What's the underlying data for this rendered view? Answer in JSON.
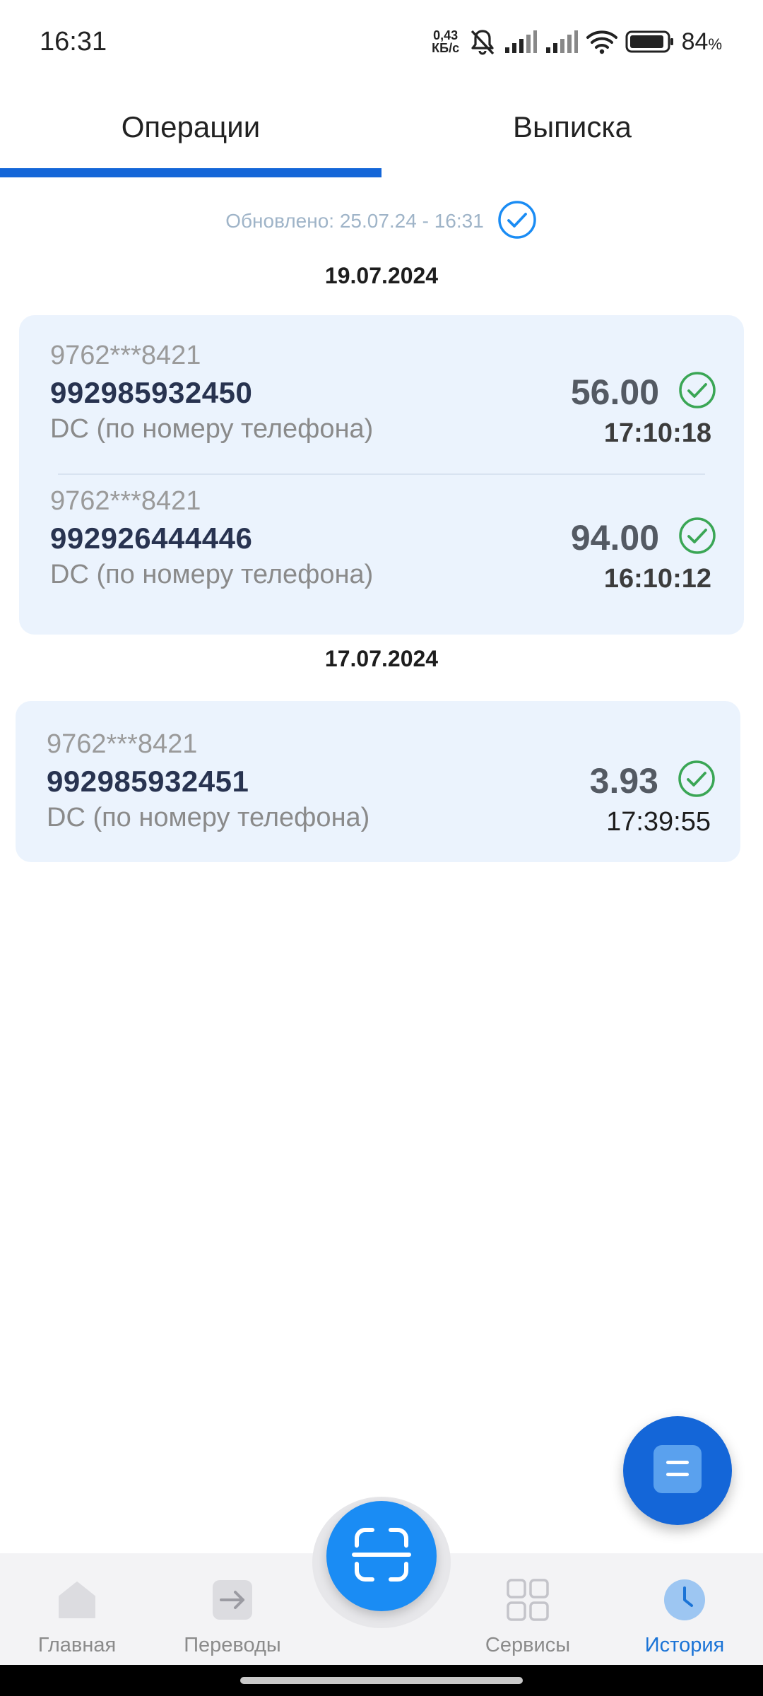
{
  "status_bar": {
    "time": "16:31",
    "net_speed_value": "0,43",
    "net_speed_unit": "КБ/с",
    "battery_percent": "84",
    "battery_symbol": "%"
  },
  "tabs": [
    {
      "label": "Операции",
      "active": true
    },
    {
      "label": "Выписка",
      "active": false
    }
  ],
  "updated": {
    "text": "Обновлено: 25.07.24 - 16:31"
  },
  "groups": [
    {
      "date": "19.07.2024",
      "transactions": [
        {
          "card": "9762***8421",
          "phone": "992985932450",
          "description": "DC (по номеру телефона)",
          "amount": "56.00",
          "time": "17:10:18"
        },
        {
          "card": "9762***8421",
          "phone": "992926444446",
          "description": "DC (по номеру телефона)",
          "amount": "94.00",
          "time": "16:10:12"
        }
      ]
    },
    {
      "date": "17.07.2024",
      "transactions": [
        {
          "card": "9762***8421",
          "phone": "992985932451",
          "description": "DC (по номеру телефона)",
          "amount": "3.93",
          "time": "17:39:55"
        }
      ]
    }
  ],
  "bottom_nav": {
    "items": [
      {
        "label": "Главная",
        "icon": "home-icon",
        "active": false
      },
      {
        "label": "Переводы",
        "icon": "arrow-right-icon",
        "active": false
      },
      {
        "label": "Сервисы",
        "icon": "grid-icon",
        "active": false
      },
      {
        "label": "История",
        "icon": "clock-icon",
        "active": true
      }
    ],
    "center_icon": "scan-icon"
  },
  "colors": {
    "accent": "#1466d8",
    "scan_button": "#1a8cf4",
    "card_background": "#ebf3fd",
    "success": "#3aa655",
    "updated_check": "#1a8cf4"
  }
}
